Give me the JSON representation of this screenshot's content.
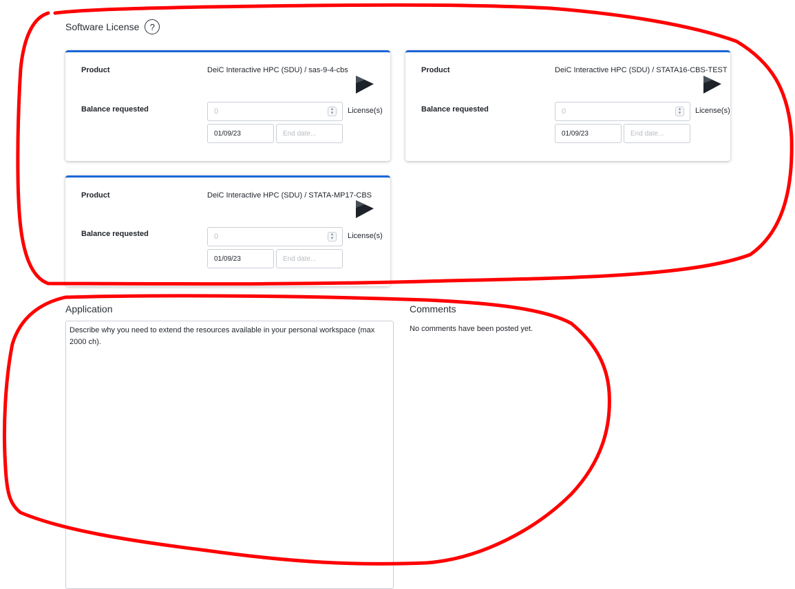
{
  "section": {
    "title": "Software License",
    "help_icon": "?"
  },
  "cards": [
    {
      "product_label": "Product",
      "product_value": "DeiC Interactive HPC (SDU) / sas-9-4-cbs",
      "balance_label": "Balance requested",
      "balance_placeholder": "0",
      "unit": "License(s)",
      "start_date": "01/09/23",
      "end_date_placeholder": "End date..."
    },
    {
      "product_label": "Product",
      "product_value": "DeiC Interactive HPC (SDU) / STATA16-CBS-TEST",
      "balance_label": "Balance requested",
      "balance_placeholder": "0",
      "unit": "License(s)",
      "start_date": "01/09/23",
      "end_date_placeholder": "End date..."
    },
    {
      "product_label": "Product",
      "product_value": "DeiC Interactive HPC (SDU) / STATA-MP17-CBS",
      "balance_label": "Balance requested",
      "balance_placeholder": "0",
      "unit": "License(s)",
      "start_date": "01/09/23",
      "end_date_placeholder": "End date..."
    }
  ],
  "application": {
    "title": "Application",
    "placeholder": "Describe why you need to extend the resources available in your personal workspace (max 2000 ch)."
  },
  "comments": {
    "title": "Comments",
    "empty_text": "No comments have been posted yet."
  },
  "colors": {
    "accent": "#1b66d6",
    "annotation": "#ff0000",
    "play_icon": "#1e2229"
  },
  "icons": {
    "help": "help-circle-icon",
    "provider": "play-icon"
  }
}
